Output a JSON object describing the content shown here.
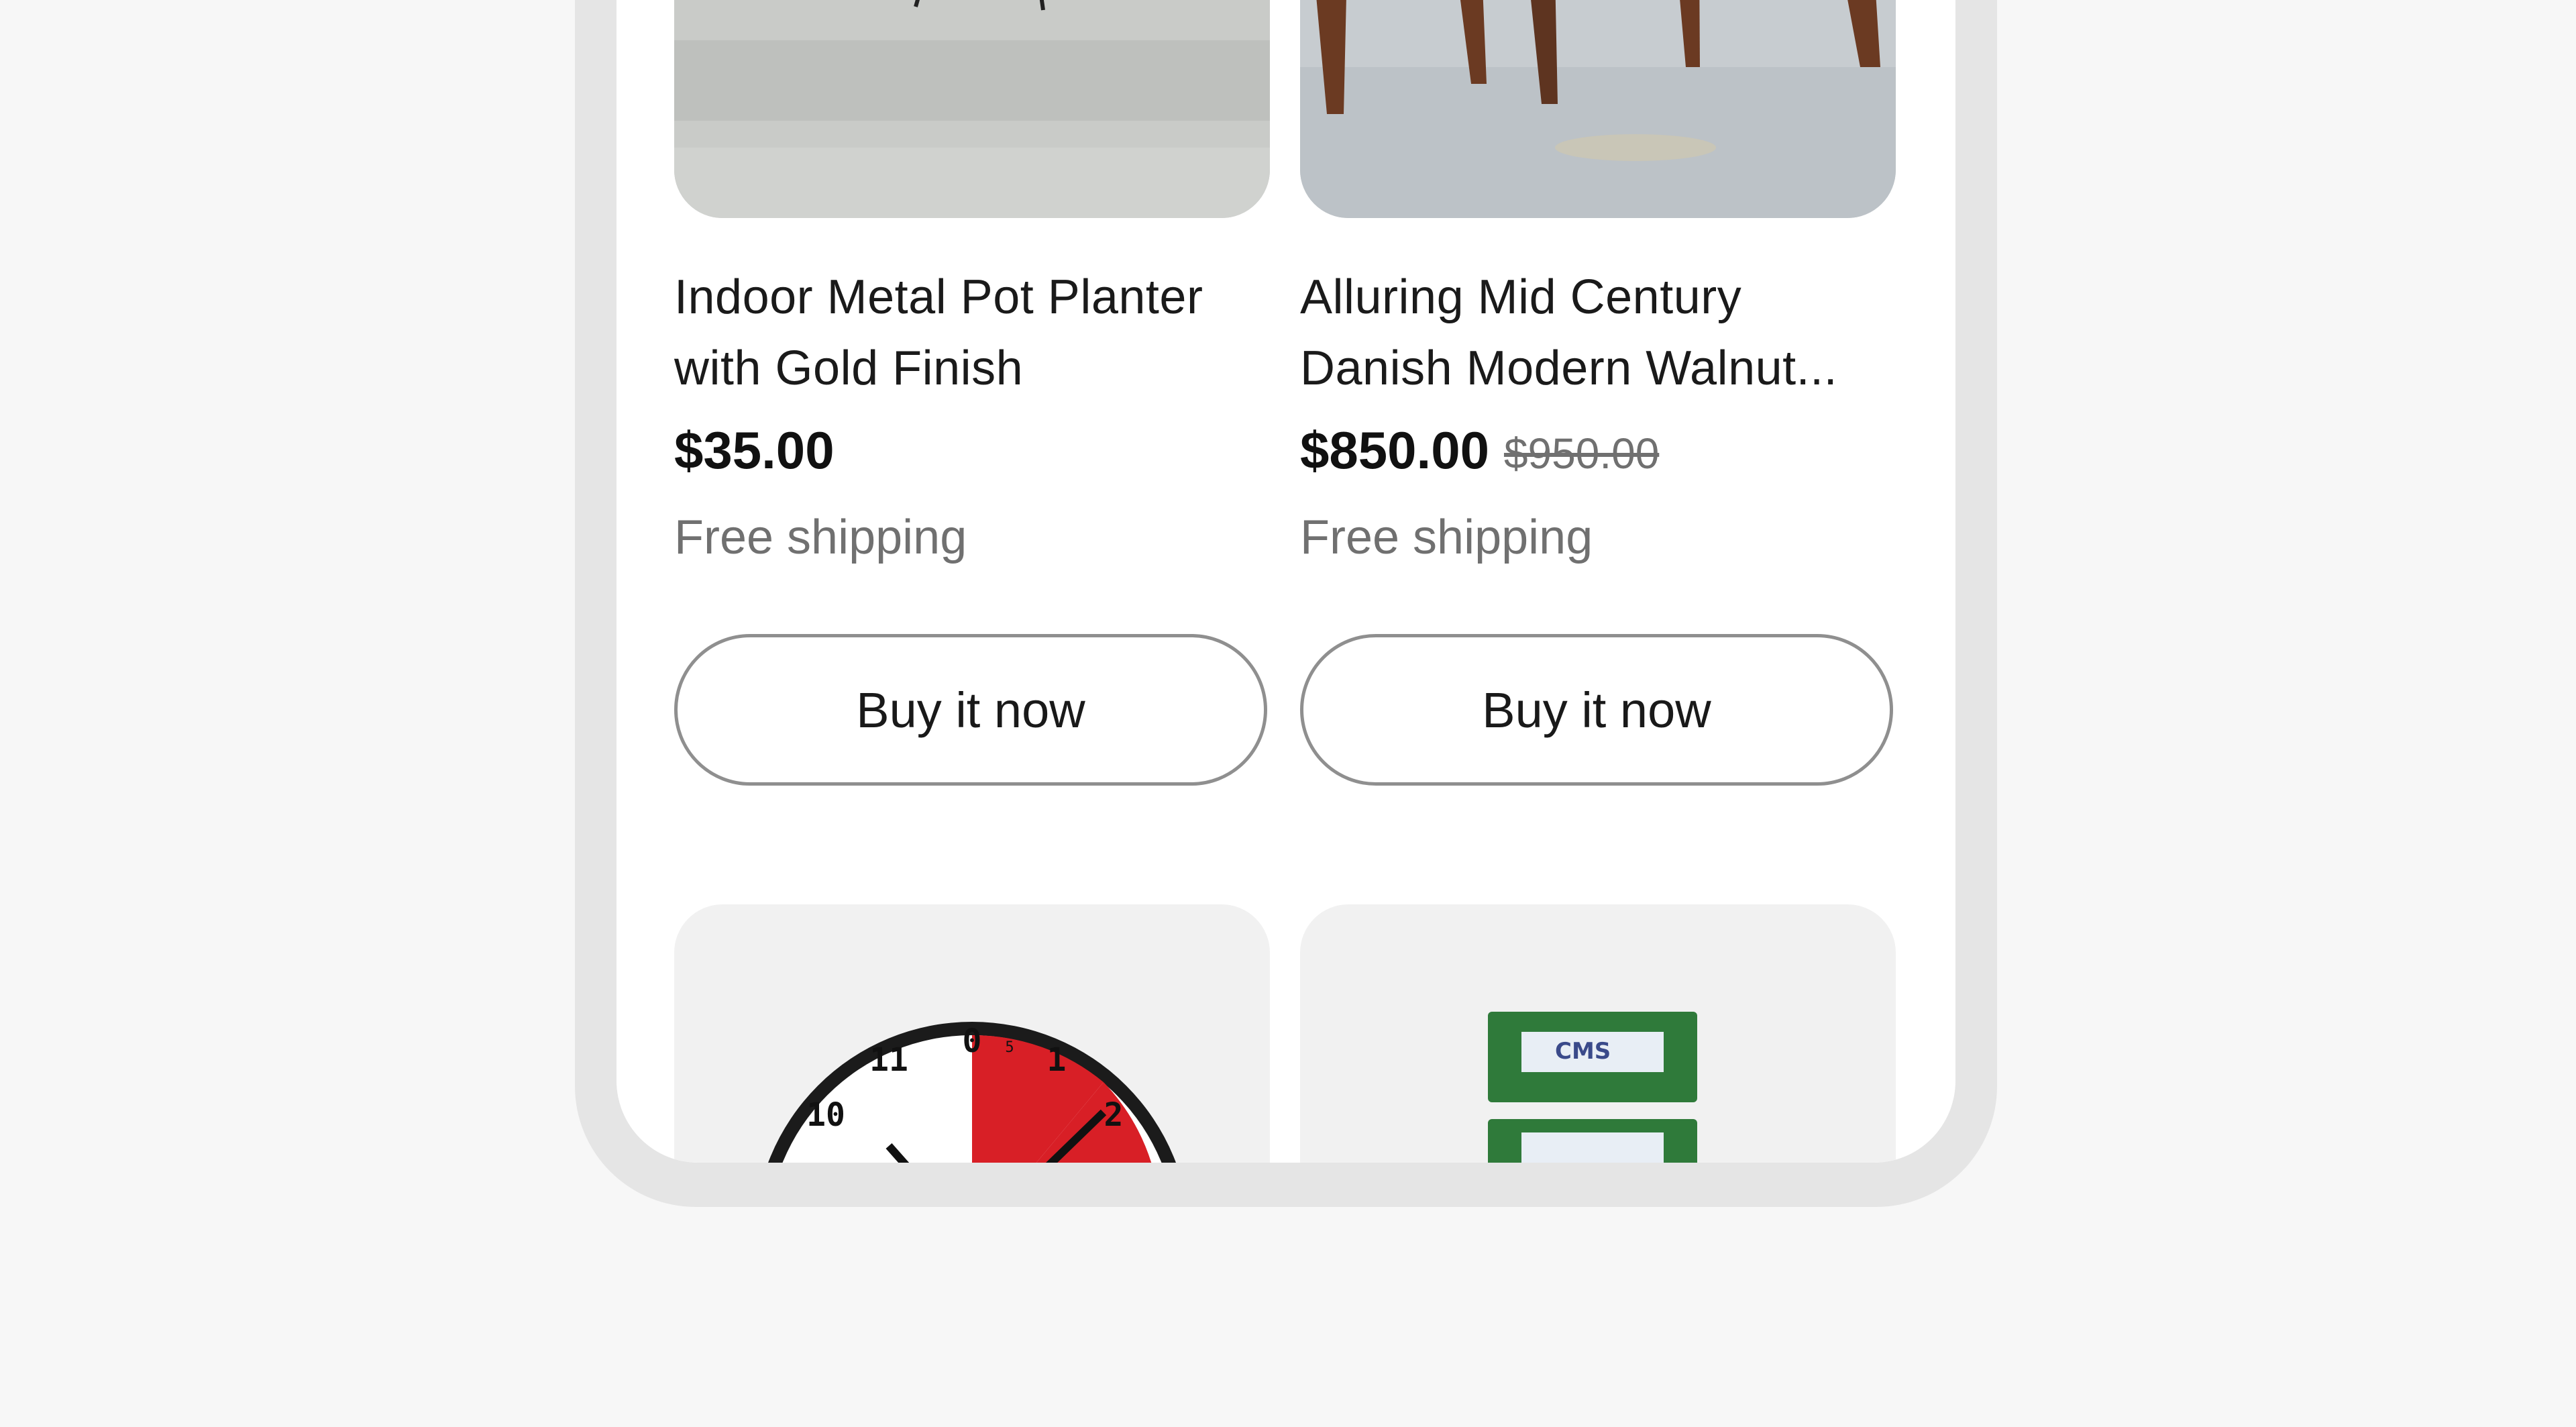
{
  "products": [
    {
      "title": "Indoor Metal Pot Planter with Gold Finish",
      "price": "$35.00",
      "original_price": "",
      "shipping": "Free shipping",
      "buy_label": "Buy it now"
    },
    {
      "title": "Alluring Mid Century Danish Modern Walnut...",
      "price": "$850.00",
      "original_price": "$950.00",
      "shipping": "Free shipping",
      "buy_label": "Buy it now"
    }
  ],
  "next_row": {
    "clock_numbers": [
      "0",
      "11",
      "10",
      "1",
      "2",
      "5"
    ],
    "ram_label": "CMS"
  },
  "colors": {
    "background": "#f7f7f7",
    "frame": "#e5e5e5",
    "button_border": "#8f8f8f",
    "clock_red": "#d81f26"
  }
}
